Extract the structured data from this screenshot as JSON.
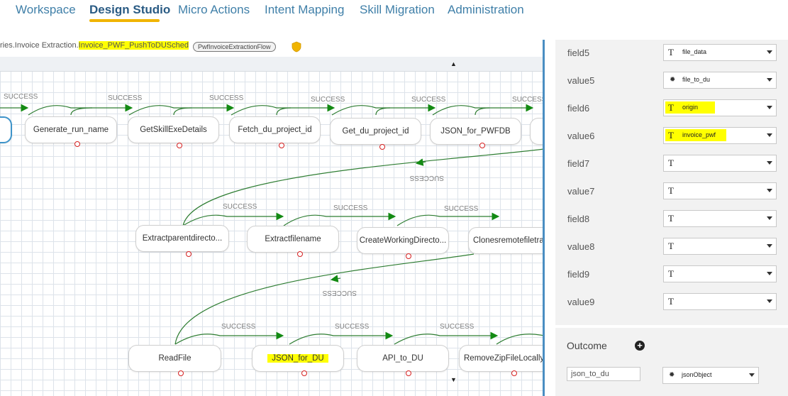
{
  "nav": {
    "tabs": [
      {
        "label": "Workspace",
        "active": false
      },
      {
        "label": "Design Studio",
        "active": true
      },
      {
        "label": "Micro Actions",
        "active": false
      },
      {
        "label": "Intent Mapping",
        "active": false
      },
      {
        "label": "Skill Migration",
        "active": false
      },
      {
        "label": "Administration",
        "active": false
      }
    ],
    "accent_color": "#f0b400"
  },
  "breadcrumb": {
    "path_prefix": "ries.Invoice Extraction.",
    "current": "Invoice_PWF_PushToDUSched",
    "flow_badge": "PwfInvoiceExtractionFlow",
    "icon": "shield-icon"
  },
  "canvas": {
    "edge_label": "SUCCESS",
    "return_label": "SUCCESS",
    "rows": [
      {
        "nodes": [
          "",
          "Generate_run_name",
          "GetSkillExeDetails",
          "Fetch_du_project_id",
          "Get_du_project_id",
          "JSON_for_PWFDB",
          ""
        ]
      },
      {
        "nodes": [
          "Extractparentdirecto...",
          "Extractfilename",
          "CreateWorkingDirecto...",
          "Clonesremotefiletra"
        ]
      },
      {
        "nodes": [
          "ReadFile",
          "JSON_for_DU",
          "API_to_DU",
          "RemoveZipFileLocally"
        ]
      }
    ],
    "highlighted_node": "JSON_for_DU"
  },
  "properties": {
    "rows": [
      {
        "label": "field5",
        "value": "file_data",
        "type_icon": "text-type-icon"
      },
      {
        "label": "value5",
        "value": "file_to_du",
        "type_icon": "gear-icon"
      },
      {
        "label": "field6",
        "value": "origin",
        "type_icon": "text-type-icon",
        "highlight": true
      },
      {
        "label": "value6",
        "value": "invoice_pwf",
        "type_icon": "text-type-icon",
        "highlight": true
      },
      {
        "label": "field7",
        "value": "",
        "type_icon": "text-type-icon"
      },
      {
        "label": "value7",
        "value": "",
        "type_icon": "text-type-icon"
      },
      {
        "label": "field8",
        "value": "",
        "type_icon": "text-type-icon"
      },
      {
        "label": "value8",
        "value": "",
        "type_icon": "text-type-icon"
      },
      {
        "label": "field9",
        "value": "",
        "type_icon": "text-type-icon"
      },
      {
        "label": "value9",
        "value": "",
        "type_icon": "text-type-icon"
      }
    ]
  },
  "outcome": {
    "title": "Outcome",
    "name_value": "json_to_du",
    "type_value": "jsonObject"
  },
  "colors": {
    "edge": "#2e7d32",
    "arrow": "#138a13",
    "highlight": "#ffff00",
    "selection": "#3d93c9"
  }
}
